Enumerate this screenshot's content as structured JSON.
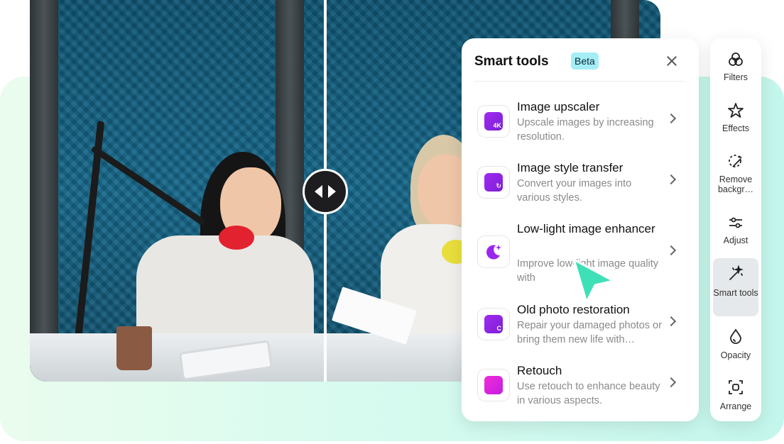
{
  "panel": {
    "title": "Smart tools",
    "badge": "Beta",
    "tools": [
      {
        "name": "Image upscaler",
        "desc": "Upscale images by increasing resolution.",
        "icon": "image-4k-icon"
      },
      {
        "name": "Image style transfer",
        "desc": "Convert your images into various styles.",
        "icon": "image-style-icon"
      },
      {
        "name": "Low-light image enhancer",
        "desc": "Improve low-light image quality with",
        "icon": "moon-sparkle-icon"
      },
      {
        "name": "Old photo restoration",
        "desc": "Repair your damaged photos or bring them new life with…",
        "icon": "photo-restore-icon"
      },
      {
        "name": "Retouch",
        "desc": "Use retouch to enhance beauty in various aspects.",
        "icon": "retouch-icon"
      }
    ]
  },
  "toolbar": {
    "items": [
      {
        "label": "Filters",
        "icon": "filters-icon"
      },
      {
        "label": "Effects",
        "icon": "effects-icon"
      },
      {
        "label": "Remove backgr…",
        "icon": "remove-background-icon"
      },
      {
        "label": "Adjust",
        "icon": "adjust-icon"
      },
      {
        "label": "Smart tools",
        "icon": "magic-wand-icon",
        "active": true
      },
      {
        "label": "Opacity",
        "icon": "opacity-icon"
      },
      {
        "label": "Arrange",
        "icon": "arrange-icon"
      }
    ]
  },
  "colors": {
    "accent_purple": "#9b27ee",
    "beta_badge": "#a6eef6",
    "pointer": "#3ee0b8"
  }
}
